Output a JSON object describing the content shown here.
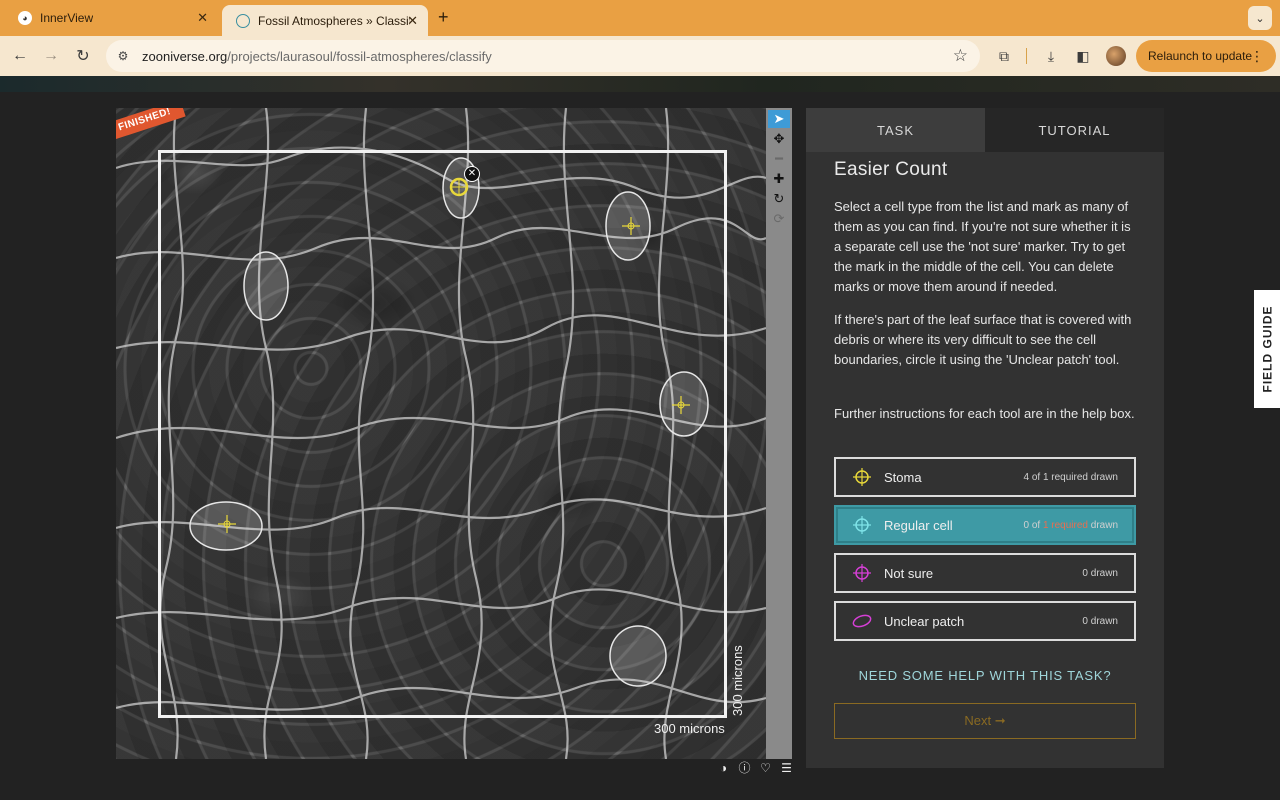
{
  "browser": {
    "tabs": [
      {
        "title": "InnerView",
        "close": "✕"
      },
      {
        "title": "Fossil Atmospheres » Classify",
        "close": "✕"
      }
    ],
    "new_tab": "+",
    "tab_search": "⌄",
    "url_domain": "zooniverse.org",
    "url_path": "/projects/laurasoul/fossil-atmospheres/classify",
    "relaunch_label": "Relaunch to update",
    "kebab": "⋮"
  },
  "subject": {
    "finished_badge": "FINISHED!",
    "scale_horizontal": "300 microns",
    "scale_vertical": "300 microns",
    "delete_mark": "✕"
  },
  "image_tools": [
    "select",
    "pan",
    "zoom-out",
    "zoom-in",
    "rotate",
    "reset"
  ],
  "task_panel": {
    "tabs": {
      "task": "TASK",
      "tutorial": "TUTORIAL"
    },
    "title": "Easier Count",
    "paragraphs": [
      "Select a cell type from the list and mark as many of them as you can find. If you're not sure whether it is a separate cell use the 'not sure' marker. Try to get the mark in the middle of the cell. You can delete marks or move them around if needed.",
      "If there's part of the leaf surface that is covered with debris or where its very difficult to see the cell boundaries, circle it using the 'Unclear patch' tool.",
      "Further instructions for each tool are in the help box."
    ],
    "tools": [
      {
        "label": "Stoma",
        "count": "4 of 1 required drawn",
        "color": "#e8d83a"
      },
      {
        "label": "Regular cell",
        "count_prefix": "0 of ",
        "count_required": "1 required",
        "count_suffix": " drawn",
        "color": "#7fe3e8"
      },
      {
        "label": "Not sure",
        "count": "0 drawn",
        "color": "#d63fd6"
      },
      {
        "label": "Unclear patch",
        "count": "0 drawn",
        "color": "#d63fd6"
      }
    ],
    "help_link": "NEED SOME HELP WITH THIS TASK?",
    "next_label": "Next ➞"
  },
  "field_guide": "FIELD GUIDE",
  "colors": {
    "accent": "#e9a043",
    "teal": "#3e9aa5",
    "stoma_marker": "#e8d83a",
    "finished": "#e0572f"
  }
}
